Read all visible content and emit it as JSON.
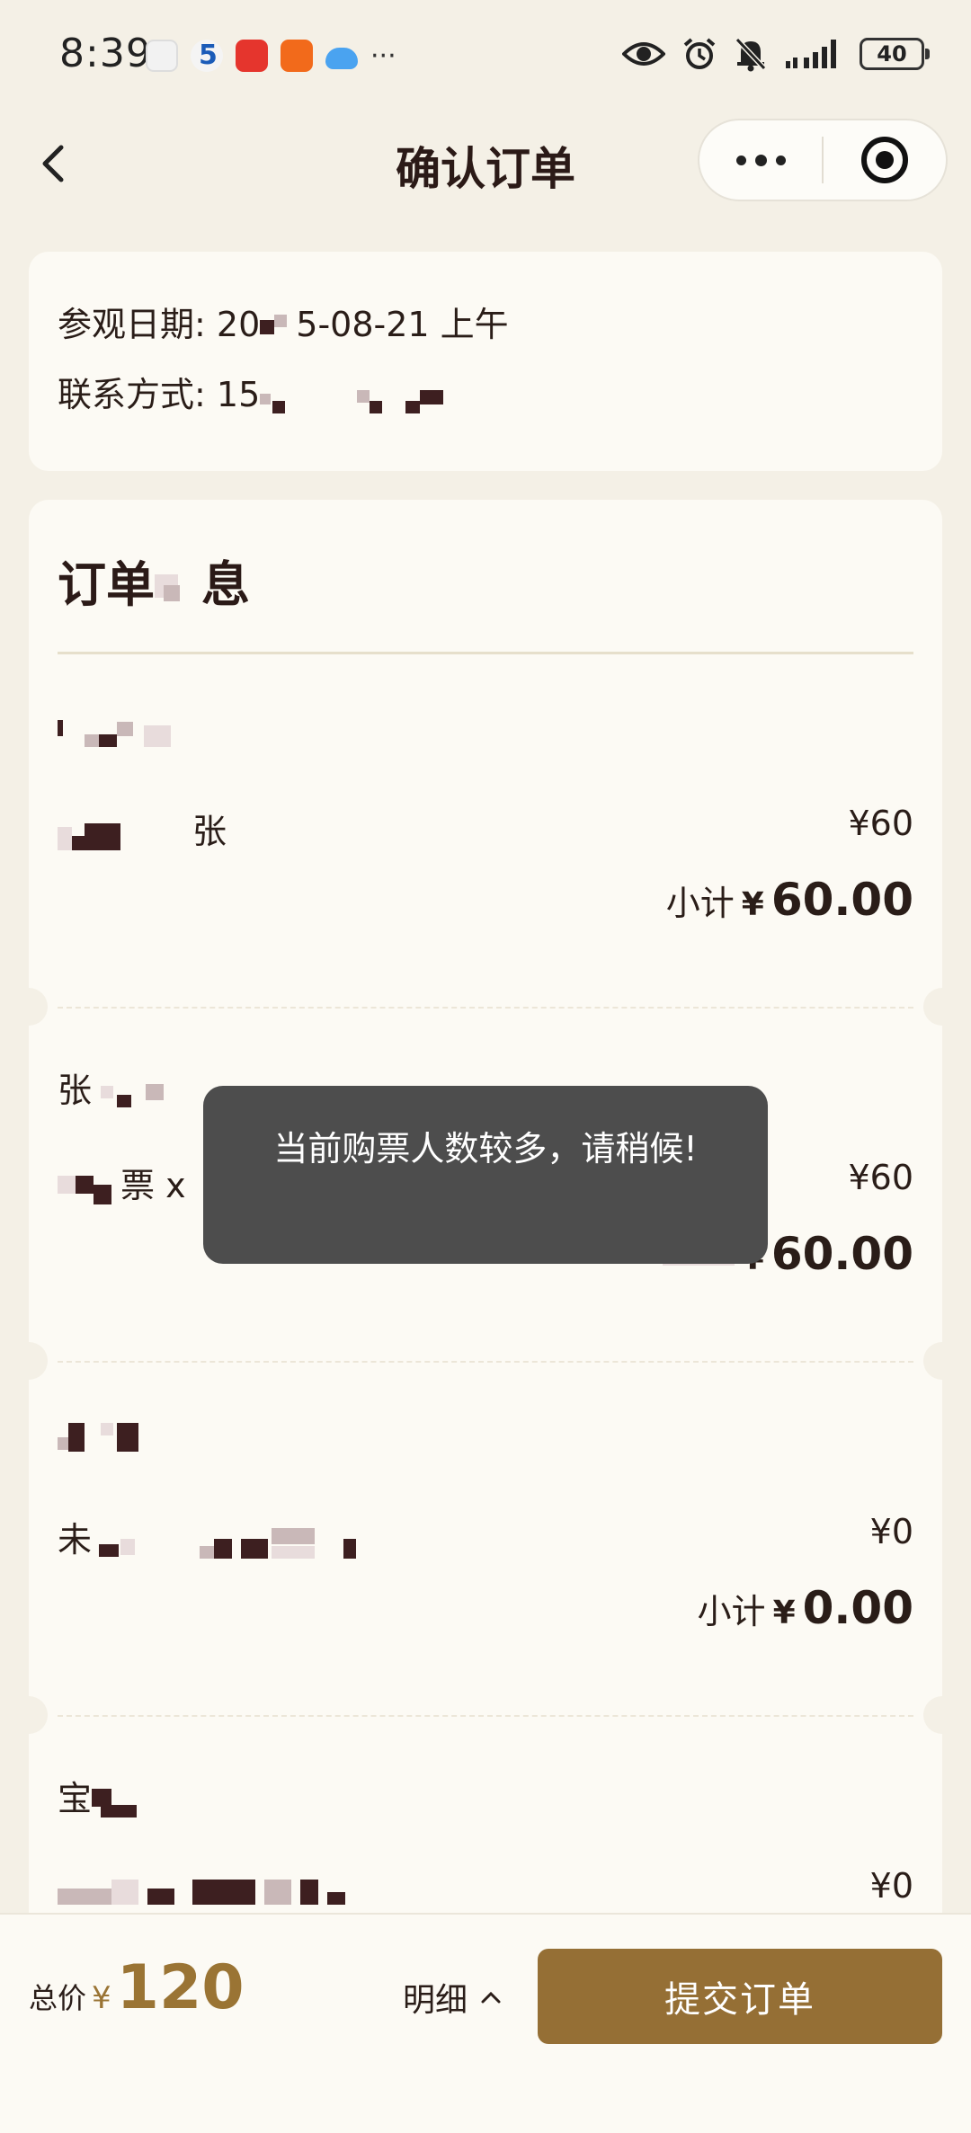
{
  "status_bar": {
    "time": "8:39",
    "more": "···",
    "battery": "40"
  },
  "nav": {
    "title": "确认订单"
  },
  "visit": {
    "date_label": "参观日期:",
    "date_value_a": "20",
    "date_value_b": "5-08-21 上午",
    "contact_label": "联系方式:",
    "contact_value": "15"
  },
  "order": {
    "title_a": "订单",
    "title_b": "息",
    "tickets": [
      {
        "spec_suffix": "张",
        "price": "¥60",
        "subtotal_label": "小计",
        "subtotal_yen": "¥",
        "subtotal_amount": "60.00"
      },
      {
        "name_prefix": "张",
        "spec_text": "票 x",
        "price": "¥60",
        "subtotal_yen": "¥",
        "subtotal_amount": "60.00"
      },
      {
        "spec_prefix": "未",
        "price": "¥0",
        "subtotal_label": "小计",
        "subtotal_yen": "¥",
        "subtotal_amount": "0.00"
      },
      {
        "name_prefix": "宝",
        "price": "¥0"
      }
    ]
  },
  "toast": {
    "message": "当前购票人数较多，请稍候!"
  },
  "bottom": {
    "total_label": "总价",
    "total_yen": "¥",
    "total_amount": "120",
    "detail_label": "明细",
    "submit_label": "提交订单"
  },
  "colors": {
    "accent": "#956f35",
    "price": "#9a7434",
    "background": "#f4f0e6",
    "card": "#fcfaf4",
    "toast": "#4d4d4d"
  }
}
